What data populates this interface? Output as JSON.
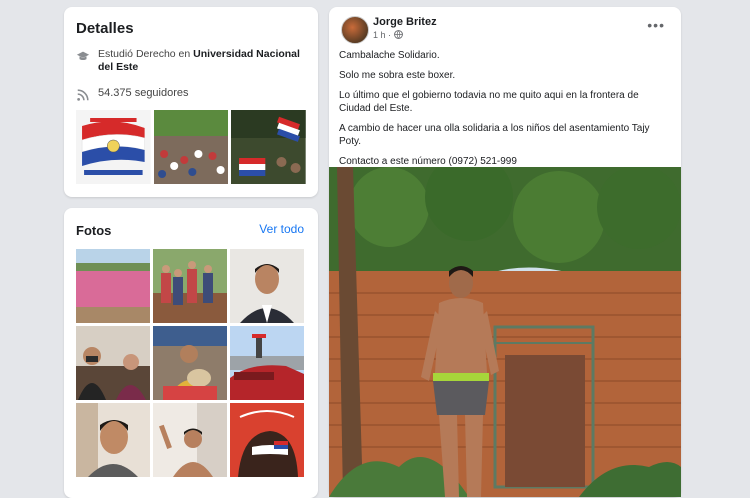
{
  "details": {
    "title": "Detalles",
    "study_prefix": "Estudió Derecho en ",
    "study_school": "Universidad Nacional del Este",
    "followers": "54.375 seguidores",
    "featured_icon_names": [
      "graduation-cap-icon",
      "rss-icon"
    ]
  },
  "photos": {
    "title": "Fotos",
    "see_all": "Ver todo"
  },
  "post": {
    "author": "Jorge Britez",
    "time": "1 h ·",
    "more": "•••",
    "paragraphs": [
      "Cambalache Solidario.",
      "Solo me sobra este boxer.",
      "Lo último que el gobierno todavia no me quito aqui en la frontera de Ciudad del Este.",
      "A cambio de hacer una olla solidaria a los niños del asentamiento Tajy Poty.",
      "Contacto a este número (0972) 521-999"
    ]
  },
  "colors": {
    "link": "#1877f2",
    "card": "#ffffff",
    "page": "#e4e6ea"
  }
}
